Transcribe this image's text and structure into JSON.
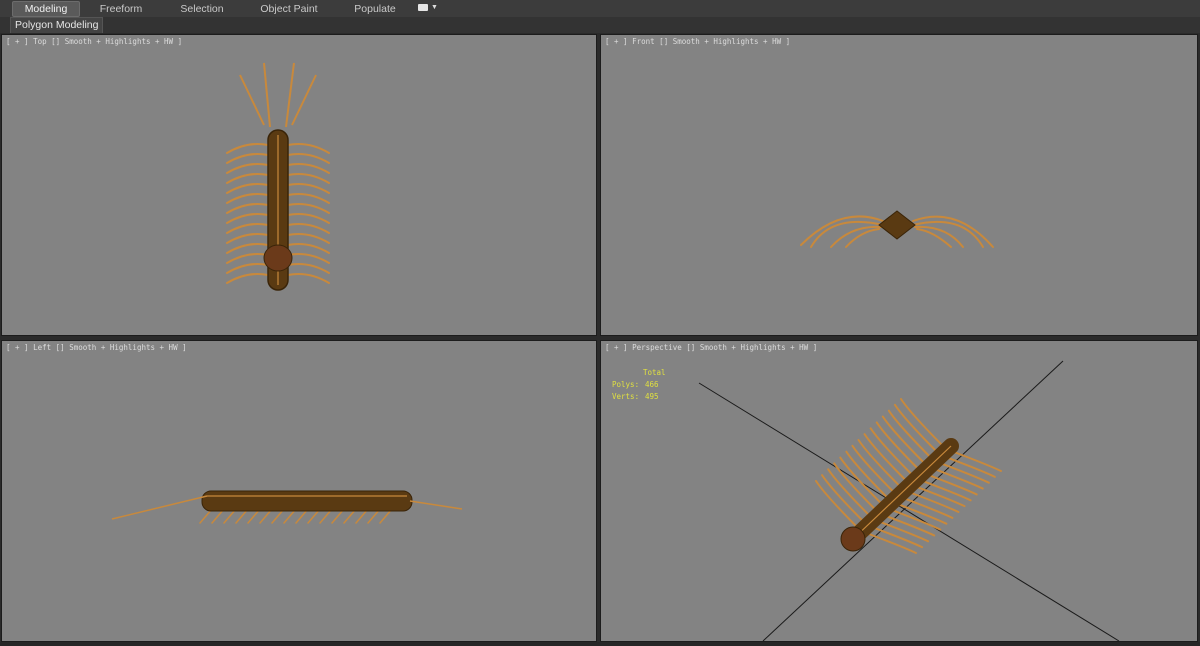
{
  "ribbon": {
    "tabs": [
      {
        "label": "Modeling",
        "active": true
      },
      {
        "label": "Freeform",
        "active": false
      },
      {
        "label": "Selection",
        "active": false
      },
      {
        "label": "Object Paint",
        "active": false
      },
      {
        "label": "Populate",
        "active": false
      }
    ],
    "options_icon": "display-options-icon"
  },
  "subbar": {
    "label": "Polygon Modeling"
  },
  "viewports": {
    "top": {
      "label": "[ + ] Top [] Smooth + Highlights + HW ]"
    },
    "front": {
      "label": "[ + ] Front [] Smooth + Highlights + HW ]"
    },
    "left": {
      "label": "[ + ] Left [] Smooth + Highlights + HW ]"
    },
    "perspective": {
      "label": "[ + ] Perspective [] Smooth + Highlights + HW ]"
    }
  },
  "stats": {
    "header": "Total",
    "polys_label": "Polys:",
    "polys_value": "466",
    "verts_label": "Verts:",
    "verts_value": "495"
  },
  "colors": {
    "viewport_bg": "#838383",
    "ribbon_bg": "#3c3c3c",
    "stats_text": "#e0e040",
    "body_brown": "#5a3a12",
    "leg_tan": "#c8893c"
  }
}
